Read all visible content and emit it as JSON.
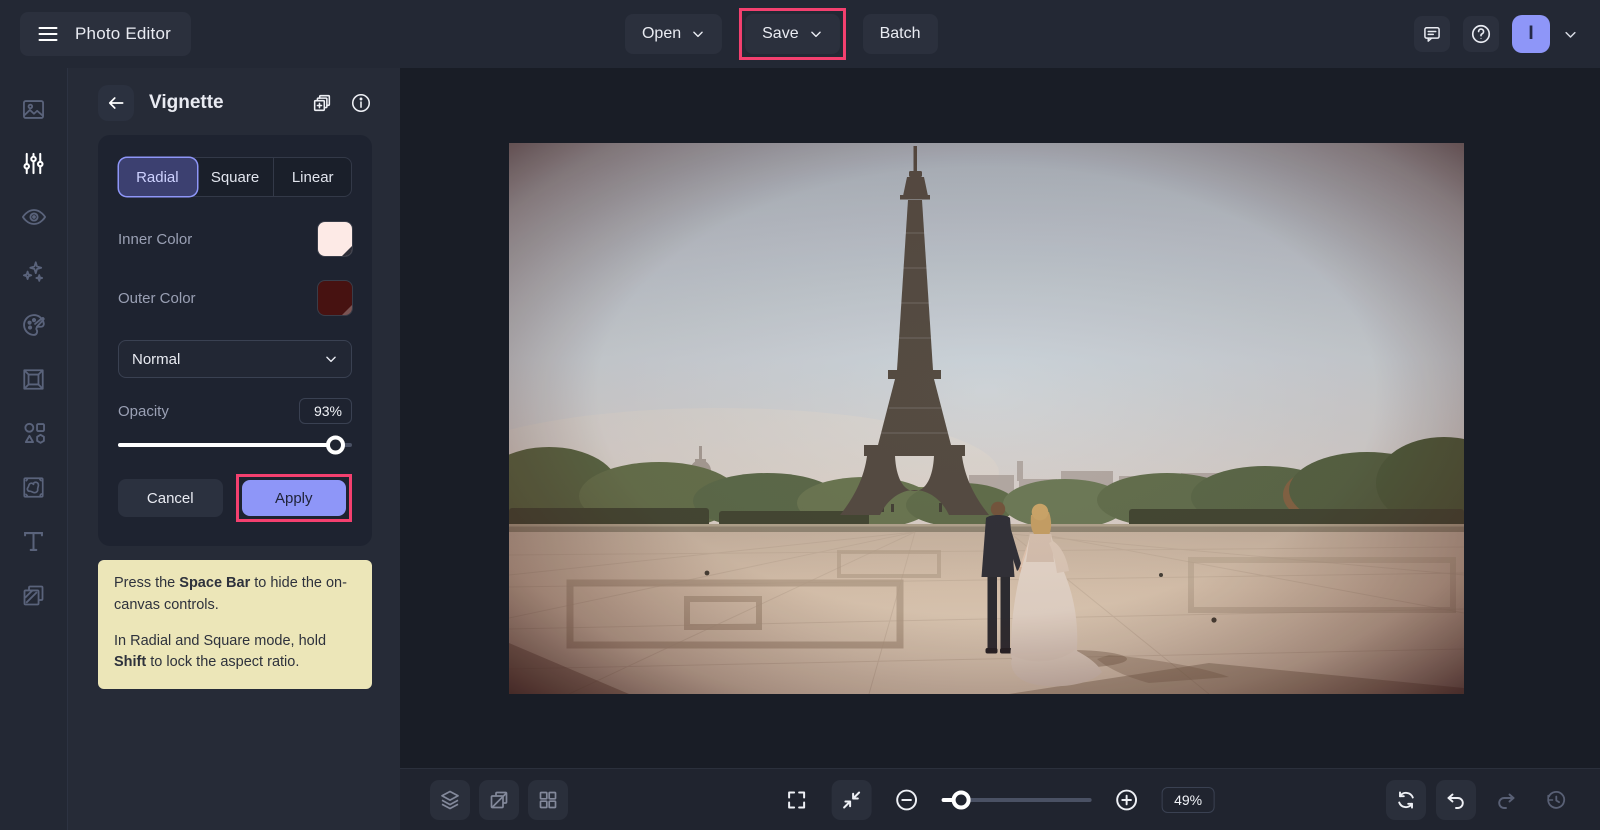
{
  "header": {
    "app_title": "Photo Editor",
    "open_label": "Open",
    "save_label": "Save",
    "batch_label": "Batch",
    "avatar_initial": "I"
  },
  "sidebar": {
    "tools": [
      {
        "name": "photo-manager"
      },
      {
        "name": "edit-adjust",
        "active": true
      },
      {
        "name": "touch-up"
      },
      {
        "name": "effects"
      },
      {
        "name": "artsy"
      },
      {
        "name": "frames"
      },
      {
        "name": "graphics"
      },
      {
        "name": "textures"
      },
      {
        "name": "text"
      },
      {
        "name": "layers"
      }
    ]
  },
  "panel": {
    "title": "Vignette",
    "tabs": [
      {
        "label": "Radial",
        "selected": true
      },
      {
        "label": "Square",
        "selected": false
      },
      {
        "label": "Linear",
        "selected": false
      }
    ],
    "inner_color": {
      "label": "Inner Color",
      "value": "#fdeae6"
    },
    "outer_color": {
      "label": "Outer Color",
      "value": "#471211"
    },
    "blend_mode": {
      "value": "Normal"
    },
    "opacity": {
      "label": "Opacity",
      "value": "93%",
      "percent": 93
    },
    "cancel_label": "Cancel",
    "apply_label": "Apply"
  },
  "note": {
    "p1_pre": "Press the ",
    "p1_bold": "Space Bar",
    "p1_post": " to hide the on-canvas controls.",
    "p2_pre": "In Radial and Square mode, hold ",
    "p2_bold": "Shift",
    "p2_post": " to lock the aspect ratio.",
    "background": "#ece6b8"
  },
  "canvas": {
    "alt": "Wedding couple walking hand in hand toward the Eiffel Tower on the Trocadero plaza, radial vignette applied"
  },
  "footer": {
    "zoom_value": "49%",
    "zoom_slider_percent": 13
  },
  "colors": {
    "annotation_accent": "#f4406f",
    "primary_accent": "#8e96f8"
  }
}
